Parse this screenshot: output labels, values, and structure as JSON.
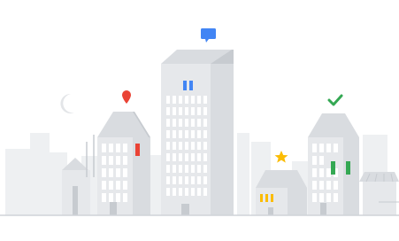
{
  "scene": {
    "colors": {
      "background": "#ffffff",
      "ground": "#cfd3d8",
      "bg_building": "#eef0f2",
      "building_light": "#e6e8eb",
      "building_mid": "#d9dce0",
      "building_shade": "#c7cbd0",
      "window": "#ffffff",
      "window_dark": "#eceef1",
      "moon": "#e3e5e8",
      "blue": "#4285f4",
      "red": "#ea4335",
      "yellow": "#fbbc04",
      "green": "#34a853"
    },
    "icons": {
      "message": "chat-bubble-icon",
      "pin": "map-pin-icon",
      "star": "star-icon",
      "check": "checkmark-icon",
      "moon": "crescent-moon-icon"
    }
  }
}
